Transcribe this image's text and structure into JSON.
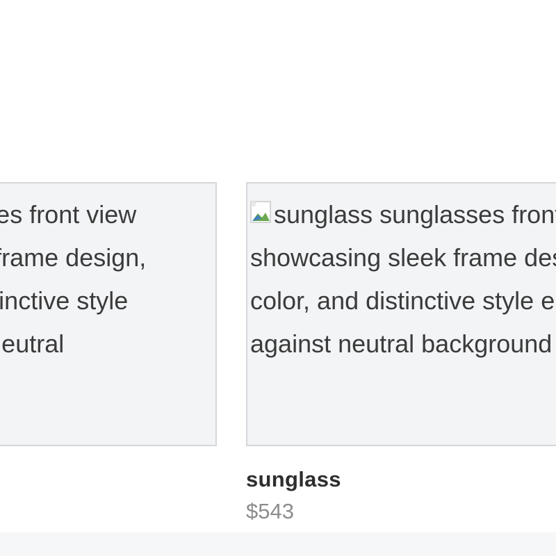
{
  "products": [
    {
      "alt_text": "sunglass sunglasses front view showcasing sleek frame design, lens color, and distinctive style elements against neutral background"
    },
    {
      "alt_text": "sunglass sunglasses front view showcasing sleek frame design, lens color, and distinctive style elements against neutral background",
      "name": "sunglass",
      "price": "$543"
    }
  ],
  "icons": {
    "broken_image": "broken-image-icon"
  },
  "colors": {
    "card_bg": "#f3f4f6",
    "card_border": "#d6d7da",
    "price": "#8d8d8d"
  }
}
